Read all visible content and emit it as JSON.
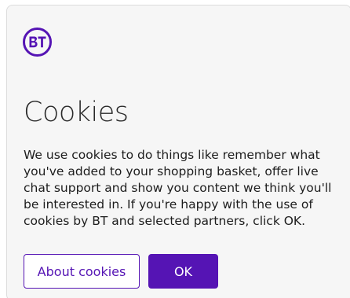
{
  "brand": {
    "logo_text": "BT",
    "accent_color": "#5514b4"
  },
  "dialog": {
    "title": "Cookies",
    "body": "We use cookies to do things like remember what you've added to your shopping basket, offer live chat support and show you content we think you'll be interested in. If you're happy with the use of cookies by BT and selected partners, click OK."
  },
  "buttons": {
    "about_label": "About cookies",
    "ok_label": "OK"
  }
}
